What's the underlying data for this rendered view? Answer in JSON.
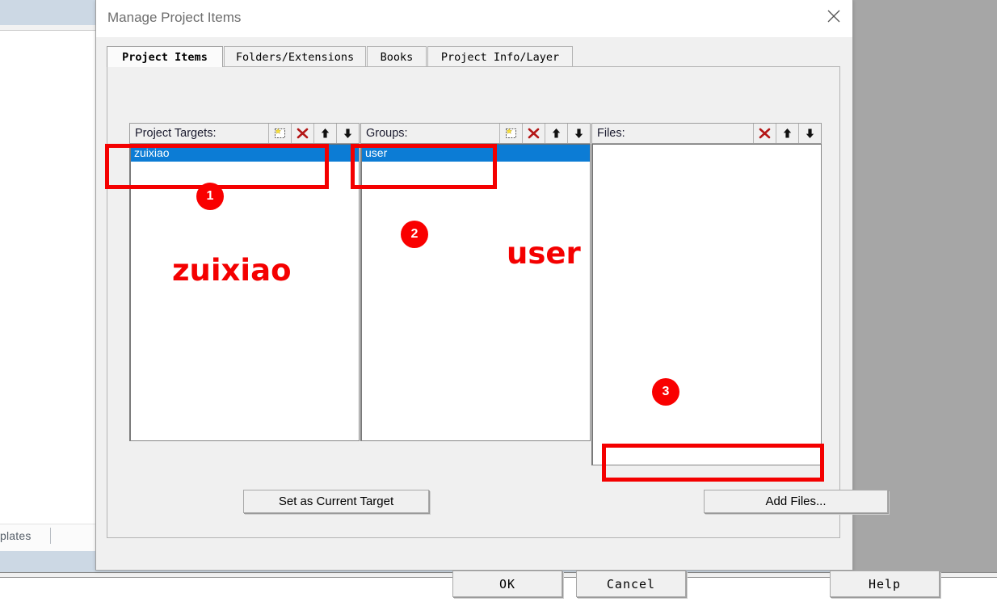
{
  "background": {
    "tab_label": "plates"
  },
  "dialog": {
    "title": "Manage Project Items",
    "close_icon": "close-icon",
    "tabs": [
      {
        "label": "Project Items",
        "active": true
      },
      {
        "label": "Folders/Extensions",
        "active": false
      },
      {
        "label": "Books",
        "active": false
      },
      {
        "label": "Project Info/Layer",
        "active": false
      }
    ],
    "panes": [
      {
        "id": "project-targets",
        "title": "Project Targets:",
        "tools": [
          "new-item-icon",
          "delete-icon",
          "move-up-icon",
          "move-down-icon"
        ],
        "items": [
          {
            "label": "zuixiao",
            "selected": true
          }
        ]
      },
      {
        "id": "groups",
        "title": "Groups:",
        "tools": [
          "new-item-icon",
          "delete-icon",
          "move-up-icon",
          "move-down-icon"
        ],
        "items": [
          {
            "label": "user",
            "selected": true
          }
        ]
      },
      {
        "id": "files",
        "title": "Files:",
        "tools": [
          "delete-icon",
          "move-up-icon",
          "move-down-icon"
        ],
        "items": []
      }
    ],
    "buttons": {
      "set_as_current_target": "Set as Current Target",
      "add_files": "Add Files...",
      "ok": "OK",
      "cancel": "Cancel",
      "help": "Help"
    }
  },
  "annotations": {
    "accent_color": "#f40000",
    "markers": [
      {
        "number": "1"
      },
      {
        "number": "2"
      },
      {
        "number": "3"
      }
    ],
    "labels": [
      {
        "text": "zuixiao"
      },
      {
        "text": "user"
      }
    ]
  }
}
